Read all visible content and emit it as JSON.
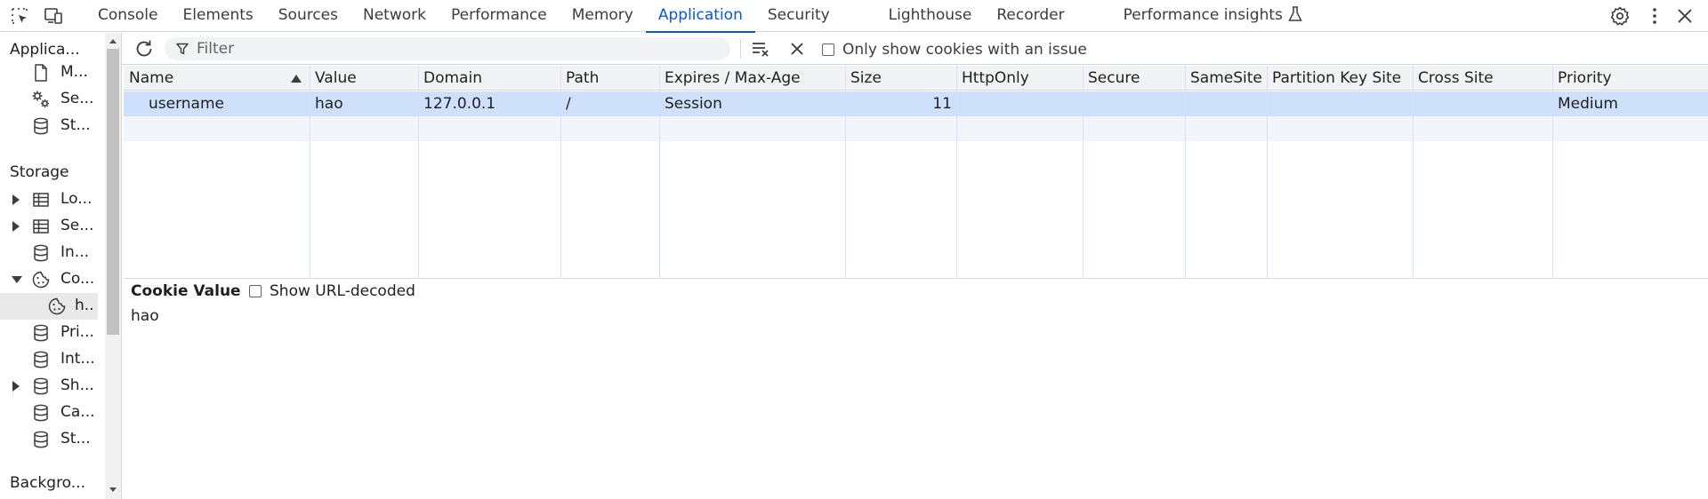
{
  "topbar": {
    "tabs": [
      {
        "label": "Console",
        "active": false
      },
      {
        "label": "Elements",
        "active": false
      },
      {
        "label": "Sources",
        "active": false
      },
      {
        "label": "Network",
        "active": false
      },
      {
        "label": "Performance",
        "active": false
      },
      {
        "label": "Memory",
        "active": false
      },
      {
        "label": "Application",
        "active": true
      },
      {
        "label": "Security",
        "active": false
      },
      {
        "label": "Lighthouse",
        "active": false
      },
      {
        "label": "Recorder",
        "active": false
      },
      {
        "label": "Performance insights",
        "active": false
      }
    ],
    "icons": [
      "inspect-element-icon",
      "device-toolbar-icon",
      "settings-icon",
      "more-options-icon",
      "close-icon"
    ],
    "accent": "#0b57d0"
  },
  "sidebar": {
    "application_heading": "Applica...",
    "application_items": [
      {
        "label": "M...",
        "icon": "document-icon"
      },
      {
        "label": "Se...",
        "icon": "gears-icon"
      },
      {
        "label": "St...",
        "icon": "database-icon"
      }
    ],
    "storage_heading": "Storage",
    "storage_items": [
      {
        "label": "Lo...",
        "icon": "table-icon",
        "expander": "collapsed"
      },
      {
        "label": "Se...",
        "icon": "table-icon",
        "expander": "collapsed"
      },
      {
        "label": "In...",
        "icon": "database-icon",
        "expander": "none"
      },
      {
        "label": "Co...",
        "icon": "cookie-icon",
        "expander": "expanded"
      },
      {
        "label": "h..",
        "icon": "cookie-icon",
        "expander": "none",
        "selected": true
      },
      {
        "label": "Pri...",
        "icon": "database-icon",
        "expander": "none"
      },
      {
        "label": "Int...",
        "icon": "database-icon",
        "expander": "none"
      },
      {
        "label": "Sh...",
        "icon": "database-icon",
        "expander": "collapsed"
      },
      {
        "label": "Ca...",
        "icon": "database-icon",
        "expander": "none"
      },
      {
        "label": "St...",
        "icon": "database-icon",
        "expander": "none"
      }
    ],
    "background_heading": "Backgro..."
  },
  "toolbar": {
    "filter_placeholder": "Filter",
    "only_issues_label": "Only show cookies with an issue",
    "only_issues_checked": false
  },
  "table": {
    "columns": [
      "Name",
      "Value",
      "Domain",
      "Path",
      "Expires / Max-Age",
      "Size",
      "HttpOnly",
      "Secure",
      "SameSite",
      "Partition Key Site",
      "Cross Site",
      "Priority"
    ],
    "sorted_column": "Name",
    "sort_direction": "ascending",
    "rows": [
      {
        "name": "username",
        "value": "hao",
        "domain": "127.0.0.1",
        "path": "/",
        "expires": "Session",
        "size": "11",
        "httponly": "",
        "secure": "",
        "samesite": "",
        "partition_key_site": "",
        "cross_site": "",
        "priority": "Medium"
      }
    ]
  },
  "cookie_value": {
    "title": "Cookie Value",
    "decode_label": "Show URL-decoded",
    "decode_checked": false,
    "value": "hao"
  }
}
